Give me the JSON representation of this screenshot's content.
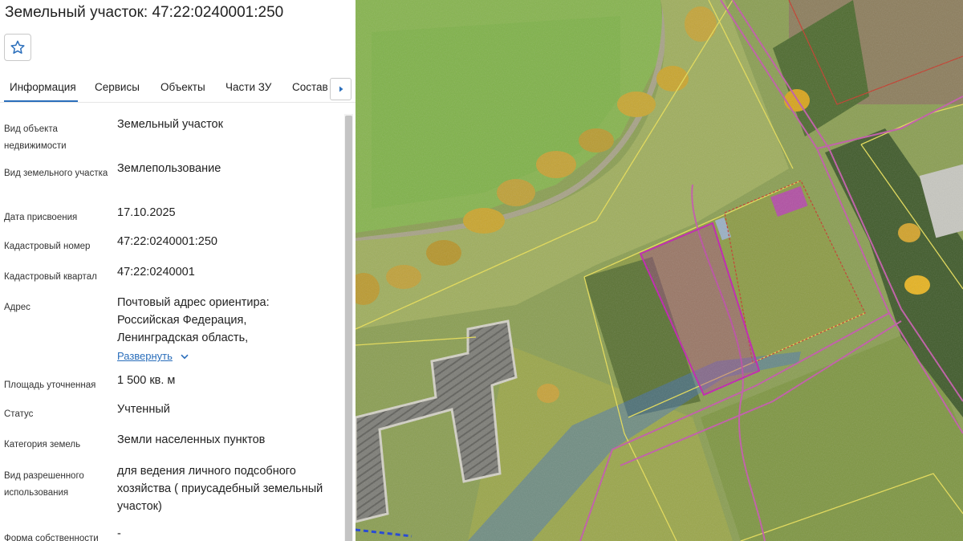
{
  "header": {
    "title": "Земельный участок: 47:22:0240001:250"
  },
  "favorite": {
    "icon": "star-icon"
  },
  "tabs": [
    {
      "label": "Информация",
      "active": true
    },
    {
      "label": "Сервисы"
    },
    {
      "label": "Объекты"
    },
    {
      "label": "Части ЗУ"
    },
    {
      "label": "Состав"
    }
  ],
  "tab_scroll_icon": "caret-right-icon",
  "fields": [
    {
      "label": "Вид объекта недвижимости",
      "value": "Земельный участок"
    },
    {
      "label": "Вид земельного участка",
      "value": "Землепользование"
    },
    {
      "label": "Дата присвоения",
      "value": "17.10.2025"
    },
    {
      "label": "Кадастровый номер",
      "value": "47:22:0240001:250"
    },
    {
      "label": "Кадастровый квартал",
      "value": "47:22:0240001"
    },
    {
      "label": "Адрес",
      "value": "Почтовый адрес ориентира: Российская Федерация, Ленинградская область,",
      "link": "Развернуть"
    },
    {
      "label": "Площадь уточненная",
      "value": "1 500 кв. м"
    },
    {
      "label": "Статус",
      "value": "Учтенный"
    },
    {
      "label": "Категория земель",
      "value": "Земли населенных пунктов"
    },
    {
      "label": "Вид разрешенного использования",
      "value": "для ведения личного подсобного хозяйства ( приусадебный земельный участок)"
    },
    {
      "label": "Форма собственности",
      "value": "-"
    }
  ],
  "colors": {
    "accent": "#2a6ebb",
    "selected_parcel": "#c21fb0",
    "parcel_border": "#e6dd55",
    "road_line": "#b8489a",
    "water_overlay": "#3d6fc8"
  }
}
